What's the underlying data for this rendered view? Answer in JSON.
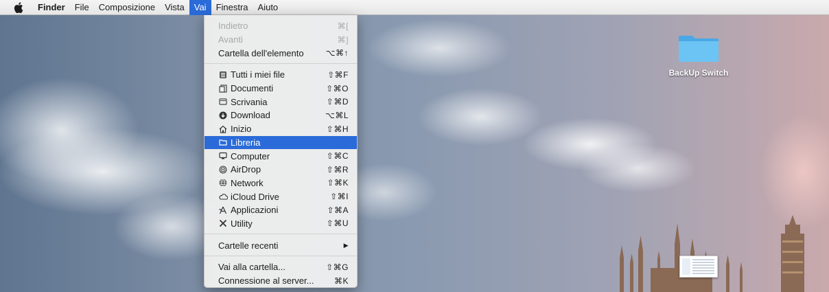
{
  "menubar": {
    "app_name": "Finder",
    "items": [
      "File",
      "Composizione",
      "Vista",
      "Vai",
      "Finestra",
      "Aiuto"
    ],
    "active": "Vai"
  },
  "go_menu": {
    "groups": [
      [
        {
          "label": "Indietro",
          "shortcut": "⌘[",
          "disabled": true
        },
        {
          "label": "Avanti",
          "shortcut": "⌘]",
          "disabled": true
        },
        {
          "label": "Cartella dell'elemento",
          "shortcut": "⌥⌘↑"
        }
      ],
      [
        {
          "label": "Tutti i miei file",
          "shortcut": "⇧⌘F",
          "icon": "all-files-icon"
        },
        {
          "label": "Documenti",
          "shortcut": "⇧⌘O",
          "icon": "documents-icon"
        },
        {
          "label": "Scrivania",
          "shortcut": "⇧⌘D",
          "icon": "desktop-icon"
        },
        {
          "label": "Download",
          "shortcut": "⌥⌘L",
          "icon": "download-icon"
        },
        {
          "label": "Inizio",
          "shortcut": "⇧⌘H",
          "icon": "home-icon"
        },
        {
          "label": "Libreria",
          "shortcut": "",
          "icon": "library-folder-icon",
          "highlighted": true
        },
        {
          "label": "Computer",
          "shortcut": "⇧⌘C",
          "icon": "computer-icon"
        },
        {
          "label": "AirDrop",
          "shortcut": "⇧⌘R",
          "icon": "airdrop-icon"
        },
        {
          "label": "Network",
          "shortcut": "⇧⌘K",
          "icon": "network-icon"
        },
        {
          "label": "iCloud Drive",
          "shortcut": "⇧⌘I",
          "icon": "icloud-icon"
        },
        {
          "label": "Applicazioni",
          "shortcut": "⇧⌘A",
          "icon": "applications-icon"
        },
        {
          "label": "Utility",
          "shortcut": "⇧⌘U",
          "icon": "utilities-icon"
        }
      ],
      [
        {
          "label": "Cartelle recenti",
          "submenu": true
        }
      ],
      [
        {
          "label": "Vai alla cartella...",
          "shortcut": "⇧⌘G"
        },
        {
          "label": "Connessione al server...",
          "shortcut": "⌘K"
        }
      ]
    ],
    "submenu_arrow": "▶"
  },
  "desktop": {
    "folder_name": "BackUp Switch"
  },
  "colors": {
    "highlight": "#2a6bd9",
    "folder": "#5ab6ec"
  }
}
